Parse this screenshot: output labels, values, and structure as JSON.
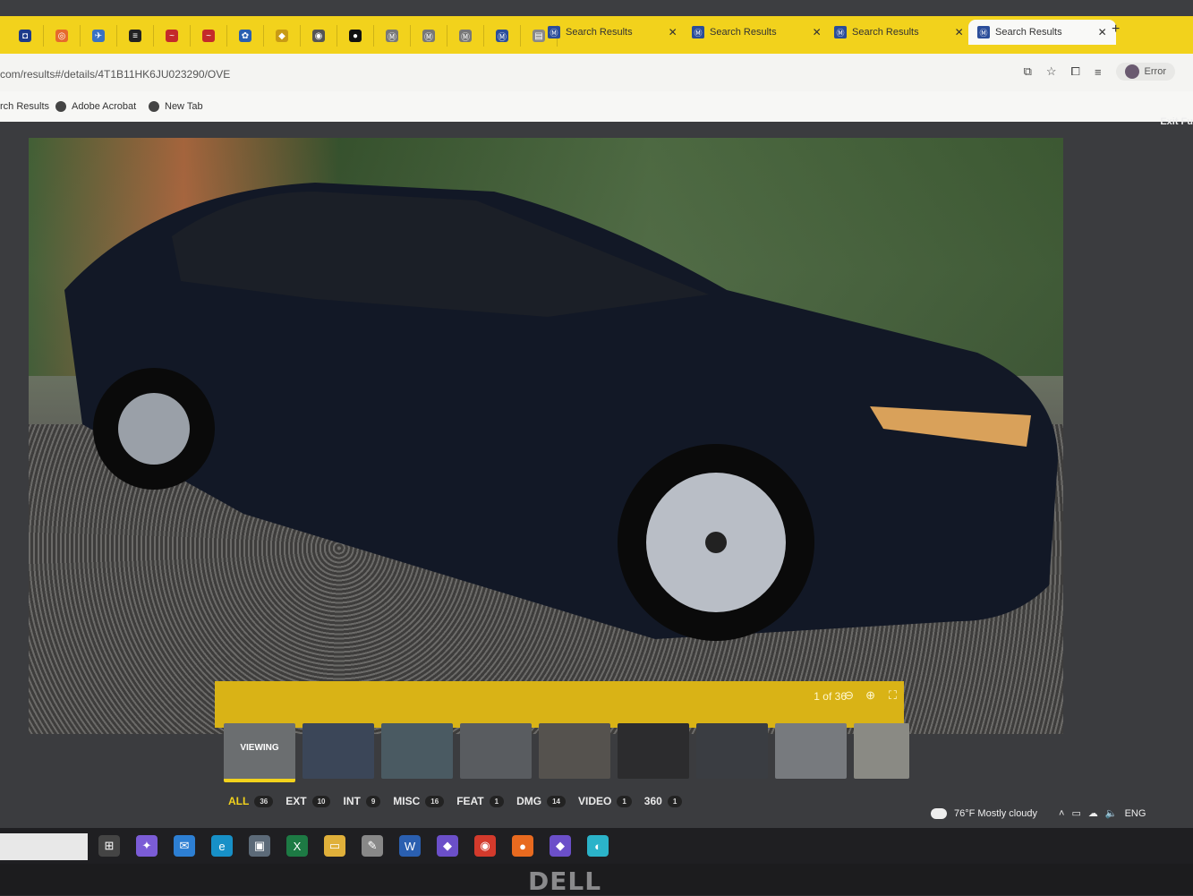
{
  "browser": {
    "tabs": [
      {
        "title": "Search Results"
      },
      {
        "title": "Search Results"
      },
      {
        "title": "Search Results"
      },
      {
        "title": "Search Results",
        "active": true
      }
    ],
    "url": "com/results#/details/4T1B11HK6JU023290/OVE",
    "profile_label": "Error",
    "bookmarks": [
      "rch Results",
      "Adobe Acrobat",
      "New Tab"
    ]
  },
  "viewer": {
    "exit_label": "Exit Fu",
    "counter": "1 of 36",
    "viewing_label": "VIEWING",
    "filters": [
      {
        "label": "ALL",
        "count": "36",
        "active": true
      },
      {
        "label": "EXT",
        "count": "10"
      },
      {
        "label": "INT",
        "count": "9"
      },
      {
        "label": "MISC",
        "count": "16"
      },
      {
        "label": "FEAT",
        "count": "1"
      },
      {
        "label": "DMG",
        "count": "14"
      },
      {
        "label": "VIDEO",
        "count": "1"
      },
      {
        "label": "360",
        "count": "1"
      }
    ]
  },
  "tray": {
    "weather": "76°F  Mostly cloudy",
    "lang": "ENG"
  },
  "monitor": {
    "brand": "DELL"
  },
  "colors": {
    "accent": "#f2d21c",
    "viewer_bg": "#3b3c3f"
  }
}
